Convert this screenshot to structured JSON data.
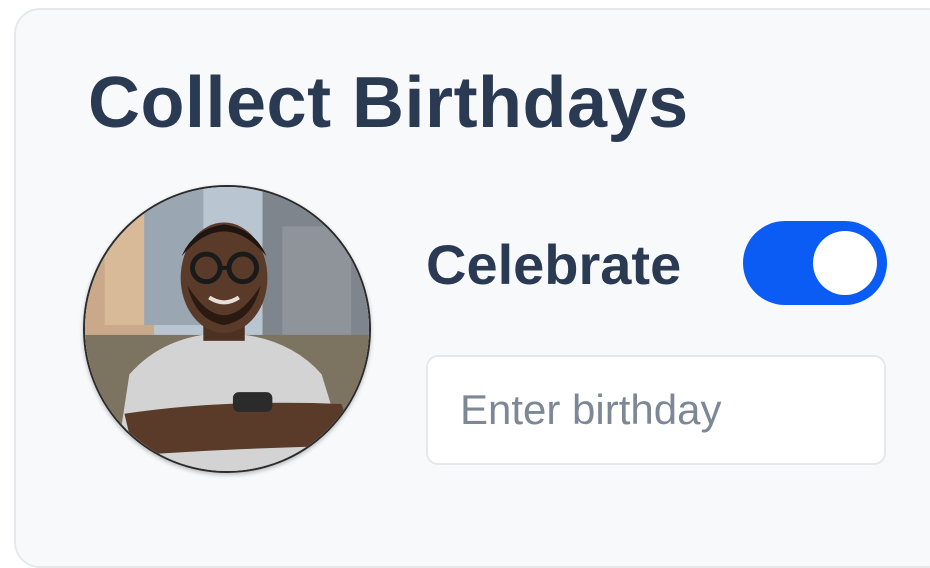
{
  "card": {
    "title": "Collect Birthdays"
  },
  "avatar": {
    "icon": "profile-photo"
  },
  "celebrate": {
    "label": "Celebrate",
    "toggle_on": true,
    "toggle_color": "#0a5cf5"
  },
  "birthday_input": {
    "value": "",
    "placeholder": "Enter birthday"
  }
}
